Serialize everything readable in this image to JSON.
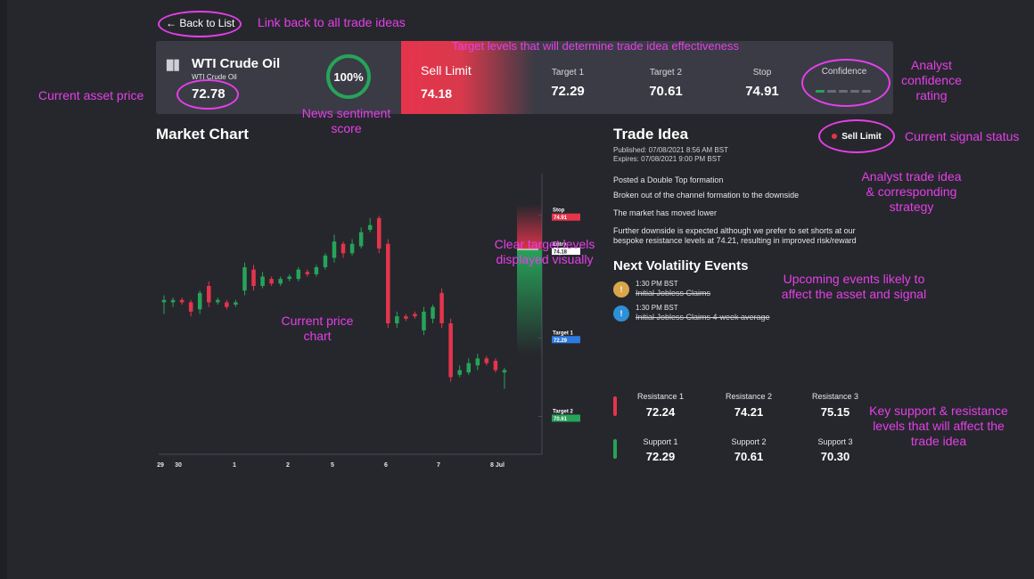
{
  "back_link": {
    "label": "Back to List"
  },
  "asset": {
    "name": "WTI Crude Oil",
    "subname": "WTI Crude Oil",
    "price": "72.78"
  },
  "sentiment": {
    "score": "100%"
  },
  "signal": {
    "label": "Sell Limit",
    "value": "74.18"
  },
  "targets": [
    {
      "label": "Target 1",
      "value": "72.29"
    },
    {
      "label": "Target 2",
      "value": "70.61"
    },
    {
      "label": "Stop",
      "value": "74.91"
    }
  ],
  "confidence": {
    "label": "Confidence",
    "filled_segments": 1,
    "total_segments": 5
  },
  "market_chart": {
    "title": "Market Chart",
    "x_ticks": [
      "29",
      "30",
      "1",
      "2",
      "5",
      "6",
      "7",
      "8 Jul"
    ],
    "levels": [
      {
        "name": "Stop",
        "value": "74.91",
        "color": "#e5344c"
      },
      {
        "name": "Entry",
        "value": "74.18",
        "color": "#ffffff"
      },
      {
        "name": "Target 1",
        "value": "72.29",
        "color": "#2d7be0"
      },
      {
        "name": "Target 2",
        "value": "70.61",
        "color": "#27a35a"
      }
    ]
  },
  "chart_data": {
    "type": "candlestick",
    "x_ticks": [
      "29",
      "30",
      "1",
      "2",
      "5",
      "6",
      "7",
      "8 Jul"
    ],
    "y_range": [
      69.8,
      75.8
    ],
    "candles": [
      {
        "o": 73.1,
        "c": 73.05,
        "h": 73.2,
        "l": 72.8,
        "d": "up"
      },
      {
        "o": 73.05,
        "c": 73.1,
        "h": 73.15,
        "l": 72.95,
        "d": "up"
      },
      {
        "o": 73.1,
        "c": 73.05,
        "h": 73.15,
        "l": 73.0,
        "d": "down"
      },
      {
        "o": 73.05,
        "c": 72.85,
        "h": 73.1,
        "l": 72.75,
        "d": "down"
      },
      {
        "o": 72.9,
        "c": 73.25,
        "h": 73.3,
        "l": 72.8,
        "d": "up"
      },
      {
        "o": 73.4,
        "c": 73.05,
        "h": 73.5,
        "l": 72.95,
        "d": "down"
      },
      {
        "o": 73.05,
        "c": 73.1,
        "h": 73.15,
        "l": 73.0,
        "d": "up"
      },
      {
        "o": 73.05,
        "c": 72.95,
        "h": 73.1,
        "l": 72.9,
        "d": "down"
      },
      {
        "o": 73.0,
        "c": 73.05,
        "h": 73.1,
        "l": 72.95,
        "d": "up"
      },
      {
        "o": 73.3,
        "c": 73.8,
        "h": 73.9,
        "l": 73.2,
        "d": "up"
      },
      {
        "o": 73.75,
        "c": 73.4,
        "h": 73.85,
        "l": 73.3,
        "d": "down"
      },
      {
        "o": 73.4,
        "c": 73.6,
        "h": 73.7,
        "l": 73.35,
        "d": "up"
      },
      {
        "o": 73.55,
        "c": 73.45,
        "h": 73.6,
        "l": 73.4,
        "d": "down"
      },
      {
        "o": 73.45,
        "c": 73.55,
        "h": 73.6,
        "l": 73.4,
        "d": "up"
      },
      {
        "o": 73.55,
        "c": 73.6,
        "h": 73.65,
        "l": 73.5,
        "d": "up"
      },
      {
        "o": 73.55,
        "c": 73.75,
        "h": 73.8,
        "l": 73.5,
        "d": "up"
      },
      {
        "o": 73.7,
        "c": 73.65,
        "h": 73.75,
        "l": 73.6,
        "d": "down"
      },
      {
        "o": 73.65,
        "c": 73.8,
        "h": 73.85,
        "l": 73.6,
        "d": "up"
      },
      {
        "o": 73.8,
        "c": 74.05,
        "h": 74.1,
        "l": 73.75,
        "d": "up"
      },
      {
        "o": 74.0,
        "c": 74.35,
        "h": 74.5,
        "l": 73.9,
        "d": "up"
      },
      {
        "o": 74.3,
        "c": 74.1,
        "h": 74.35,
        "l": 74.0,
        "d": "down"
      },
      {
        "o": 74.1,
        "c": 74.3,
        "h": 74.4,
        "l": 74.05,
        "d": "up"
      },
      {
        "o": 74.25,
        "c": 74.55,
        "h": 74.65,
        "l": 74.2,
        "d": "up"
      },
      {
        "o": 74.6,
        "c": 74.7,
        "h": 74.85,
        "l": 74.55,
        "d": "up"
      },
      {
        "o": 74.85,
        "c": 74.2,
        "h": 74.9,
        "l": 74.1,
        "d": "down"
      },
      {
        "o": 74.3,
        "c": 72.6,
        "h": 74.4,
        "l": 72.5,
        "d": "down"
      },
      {
        "o": 72.6,
        "c": 72.75,
        "h": 72.85,
        "l": 72.5,
        "d": "up"
      },
      {
        "o": 72.75,
        "c": 72.7,
        "h": 72.8,
        "l": 72.65,
        "d": "down"
      },
      {
        "o": 72.8,
        "c": 72.75,
        "h": 72.85,
        "l": 72.7,
        "d": "down"
      },
      {
        "o": 72.45,
        "c": 72.85,
        "h": 72.95,
        "l": 72.35,
        "d": "up"
      },
      {
        "o": 72.7,
        "c": 72.95,
        "h": 73.0,
        "l": 72.6,
        "d": "up"
      },
      {
        "o": 73.25,
        "c": 72.6,
        "h": 73.35,
        "l": 72.5,
        "d": "down"
      },
      {
        "o": 72.6,
        "c": 71.45,
        "h": 72.7,
        "l": 71.35,
        "d": "down"
      },
      {
        "o": 71.5,
        "c": 71.6,
        "h": 71.7,
        "l": 71.45,
        "d": "up"
      },
      {
        "o": 71.55,
        "c": 71.75,
        "h": 71.85,
        "l": 71.5,
        "d": "up"
      },
      {
        "o": 71.7,
        "c": 71.85,
        "h": 71.95,
        "l": 71.6,
        "d": "up"
      },
      {
        "o": 71.85,
        "c": 71.75,
        "h": 71.9,
        "l": 71.7,
        "d": "down"
      },
      {
        "o": 71.8,
        "c": 71.6,
        "h": 71.85,
        "l": 71.55,
        "d": "down"
      },
      {
        "o": 71.6,
        "c": 71.55,
        "h": 71.65,
        "l": 71.2,
        "d": "up"
      }
    ]
  },
  "trade_idea": {
    "title": "Trade Idea",
    "published": "Published: 07/08/2021 8:56 AM BST",
    "expires": "Expires: 07/08/2021 9:00 PM BST",
    "status": "Sell Limit",
    "points": [
      "Posted a Double Top formation",
      "Broken out of the channel formation to the downside",
      "The market has moved lower",
      "Further downside is expected although we prefer to set shorts at our bespoke resistance levels at 74.21, resulting in improved risk/reward"
    ]
  },
  "volatility": {
    "title": "Next Volatility Events",
    "events": [
      {
        "time": "1:30 PM BST",
        "name": "Initial Jobless Claims",
        "icon": "!",
        "color": "#d9a64a"
      },
      {
        "time": "1:30 PM BST",
        "name": "Initial Jobless Claims 4-week average",
        "icon": "!",
        "color": "#2d8fd6"
      }
    ]
  },
  "levels": {
    "resistance": [
      {
        "label": "Resistance 1",
        "value": "72.24"
      },
      {
        "label": "Resistance 2",
        "value": "74.21"
      },
      {
        "label": "Resistance 3",
        "value": "75.15"
      }
    ],
    "support": [
      {
        "label": "Support 1",
        "value": "72.29"
      },
      {
        "label": "Support 2",
        "value": "70.61"
      },
      {
        "label": "Support 3",
        "value": "70.30"
      }
    ]
  },
  "annotations": {
    "back": "Link back to all trade ideas",
    "targets": "Target levels that will determine trade idea effectiveness",
    "current_price": "Current asset price",
    "sentiment_line1": "News sentiment",
    "sentiment_line2": "score",
    "confidence_line1": "Analyst",
    "confidence_line2": "confidence",
    "confidence_line3": "rating",
    "signal_status": "Current signal status",
    "trade_idea_line1": "Analyst trade idea",
    "trade_idea_line2": "& corresponding",
    "trade_idea_line3": "strategy",
    "target_visual_line1": "Clear target levels",
    "target_visual_line2": "displayed visually",
    "price_chart_line1": "Current price",
    "price_chart_line2": "chart",
    "events_line1": "Upcoming events likely to",
    "events_line2": "affect the asset and signal",
    "levels_line1": "Key support & resistance",
    "levels_line2": "levels that will affect the",
    "levels_line3": "trade idea"
  },
  "colors": {
    "bear": "#e5344c",
    "bull": "#27a35a",
    "accent": "#e53fe9",
    "target1": "#2d7be0"
  }
}
